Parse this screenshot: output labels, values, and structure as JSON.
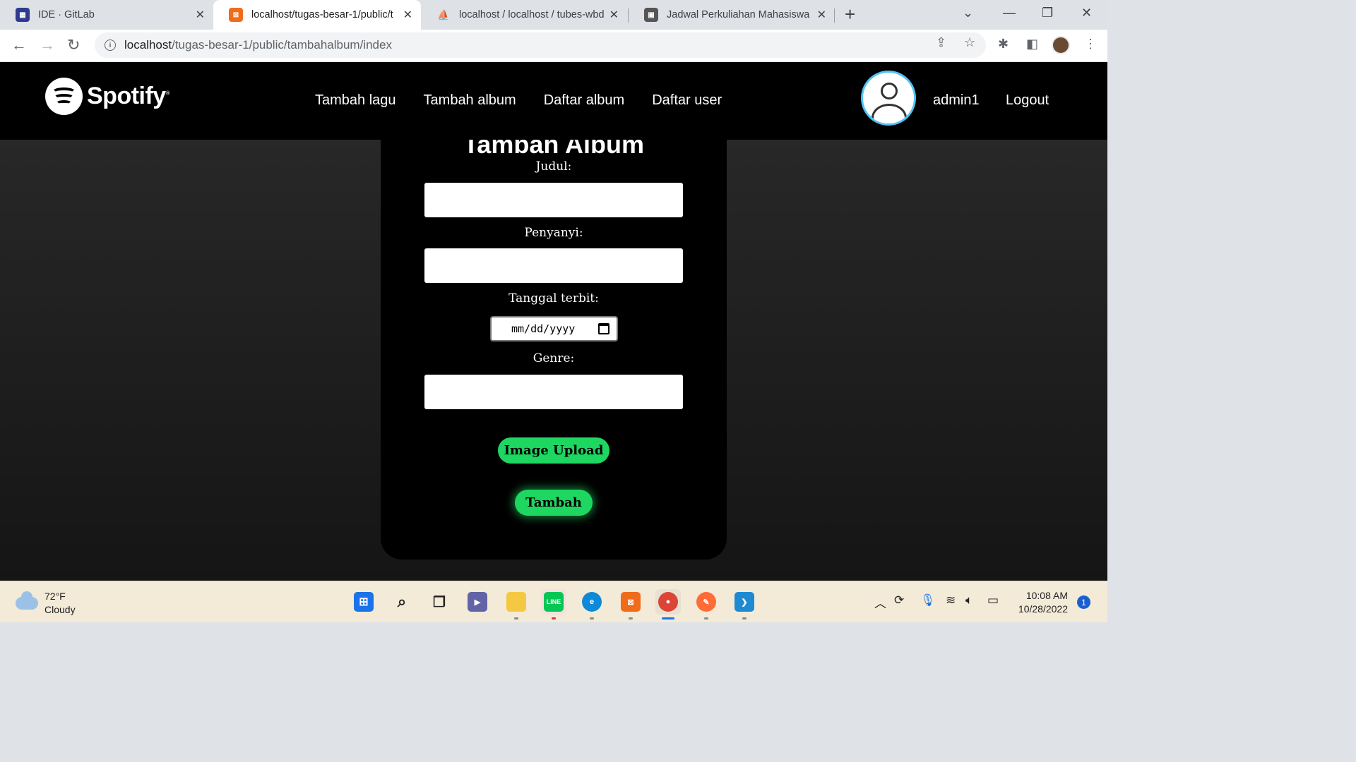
{
  "browser": {
    "tabs": [
      {
        "title": "IDE · GitLab",
        "icon": "gitlab-ide-icon",
        "color": "#2e3b8f"
      },
      {
        "title": "localhost/tugas-besar-1/public/t",
        "icon": "xampp-icon",
        "color": "#f06c1b"
      },
      {
        "title": "localhost / localhost / tubes-wbd",
        "icon": "phpmyadmin-icon",
        "color": "#e8a33d"
      },
      {
        "title": "Jadwal Perkuliahan Mahasiswa | S",
        "icon": "campus-icon",
        "color": "#555555"
      }
    ],
    "url_host": "localhost",
    "url_path": "/tugas-besar-1/public/tambahalbum/index"
  },
  "header": {
    "logo_text": "Spotify",
    "nav": [
      "Tambah lagu",
      "Tambah album",
      "Daftar album",
      "Daftar user"
    ],
    "username": "admin1",
    "logout": "Logout"
  },
  "form": {
    "title": "Tambah Album",
    "judul_label": "Judul:",
    "judul_value": "",
    "penyanyi_label": "Penyanyi:",
    "penyanyi_value": "",
    "tanggal_label": "Tanggal terbit:",
    "tanggal_placeholder": "mm/dd/yyyy",
    "genre_label": "Genre:",
    "genre_value": "",
    "upload_button": "Image Upload",
    "submit_button": "Tambah",
    "accent_color": "#1ed760"
  },
  "taskbar": {
    "temperature": "72°F",
    "weather": "Cloudy",
    "time": "10:08 AM",
    "date": "10/28/2022",
    "notifications": "1"
  }
}
